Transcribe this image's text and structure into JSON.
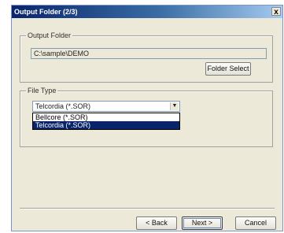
{
  "window": {
    "title": "Output Folder (2/3)",
    "close_label": "x"
  },
  "output_folder": {
    "legend": "Output Folder",
    "path": "C:\\sample\\DEMO",
    "select_button": "Folder Select"
  },
  "file_type": {
    "legend": "File Type",
    "selected": "Telcordia (*.SOR)",
    "options": [
      "Bellcore (*.SOR)",
      "Telcordia (*.SOR)"
    ],
    "highlighted_index": 1
  },
  "buttons": {
    "back": "< Back",
    "next": "Next >",
    "cancel": "Cancel"
  }
}
